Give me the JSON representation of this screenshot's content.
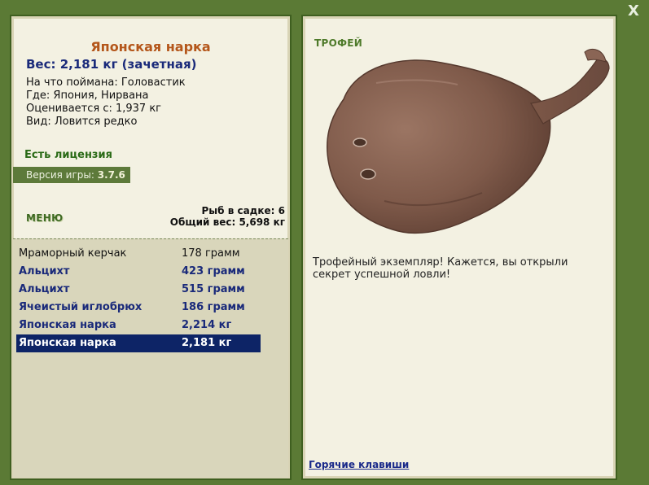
{
  "window": {
    "close_label": "X"
  },
  "fish": {
    "name": "Японская нарка",
    "weight_line": "Вес: 2,181 кг (зачетная)",
    "bait": "На что поймана: Головастик",
    "place": "Где: Япония, Нирвана",
    "price": "Оценивается с: 1,937 кг",
    "kind": "Вид: Ловится редко"
  },
  "license": "Есть лицензия",
  "version": {
    "label": "Версия игры:",
    "value": "3.7.6"
  },
  "menu_label": "МЕНЮ",
  "cage": {
    "count": "Рыб в садке: 6",
    "total_weight": "Общий вес: 5,698 кг"
  },
  "catch_list": [
    {
      "name": "Мраморный керчак",
      "weight": "178 грамм",
      "trophy": false,
      "selected": false
    },
    {
      "name": "Альцихт",
      "weight": "423 грамм",
      "trophy": true,
      "selected": false
    },
    {
      "name": "Альцихт",
      "weight": "515 грамм",
      "trophy": true,
      "selected": false
    },
    {
      "name": "Ячеистый иглобрюх",
      "weight": "186 грамм",
      "trophy": true,
      "selected": false
    },
    {
      "name": "Японская нарка",
      "weight": "2,214 кг",
      "trophy": true,
      "selected": false
    },
    {
      "name": "Японская нарка",
      "weight": "2,181 кг",
      "trophy": true,
      "selected": true
    }
  ],
  "trophy_label": "ТРОФЕЙ",
  "trophy_text": "Трофейный экземпляр! Кажется, вы открыли секрет успешной ловли!",
  "hotkeys_link": "Горячие клавиши",
  "colors": {
    "background": "#5b7a35",
    "panel": "#f3f1e2",
    "list_bg": "#d9d6bb",
    "selected_row": "#0d2466",
    "fish_name": "#b4561a",
    "trophy_blue": "#1a2a7a"
  }
}
